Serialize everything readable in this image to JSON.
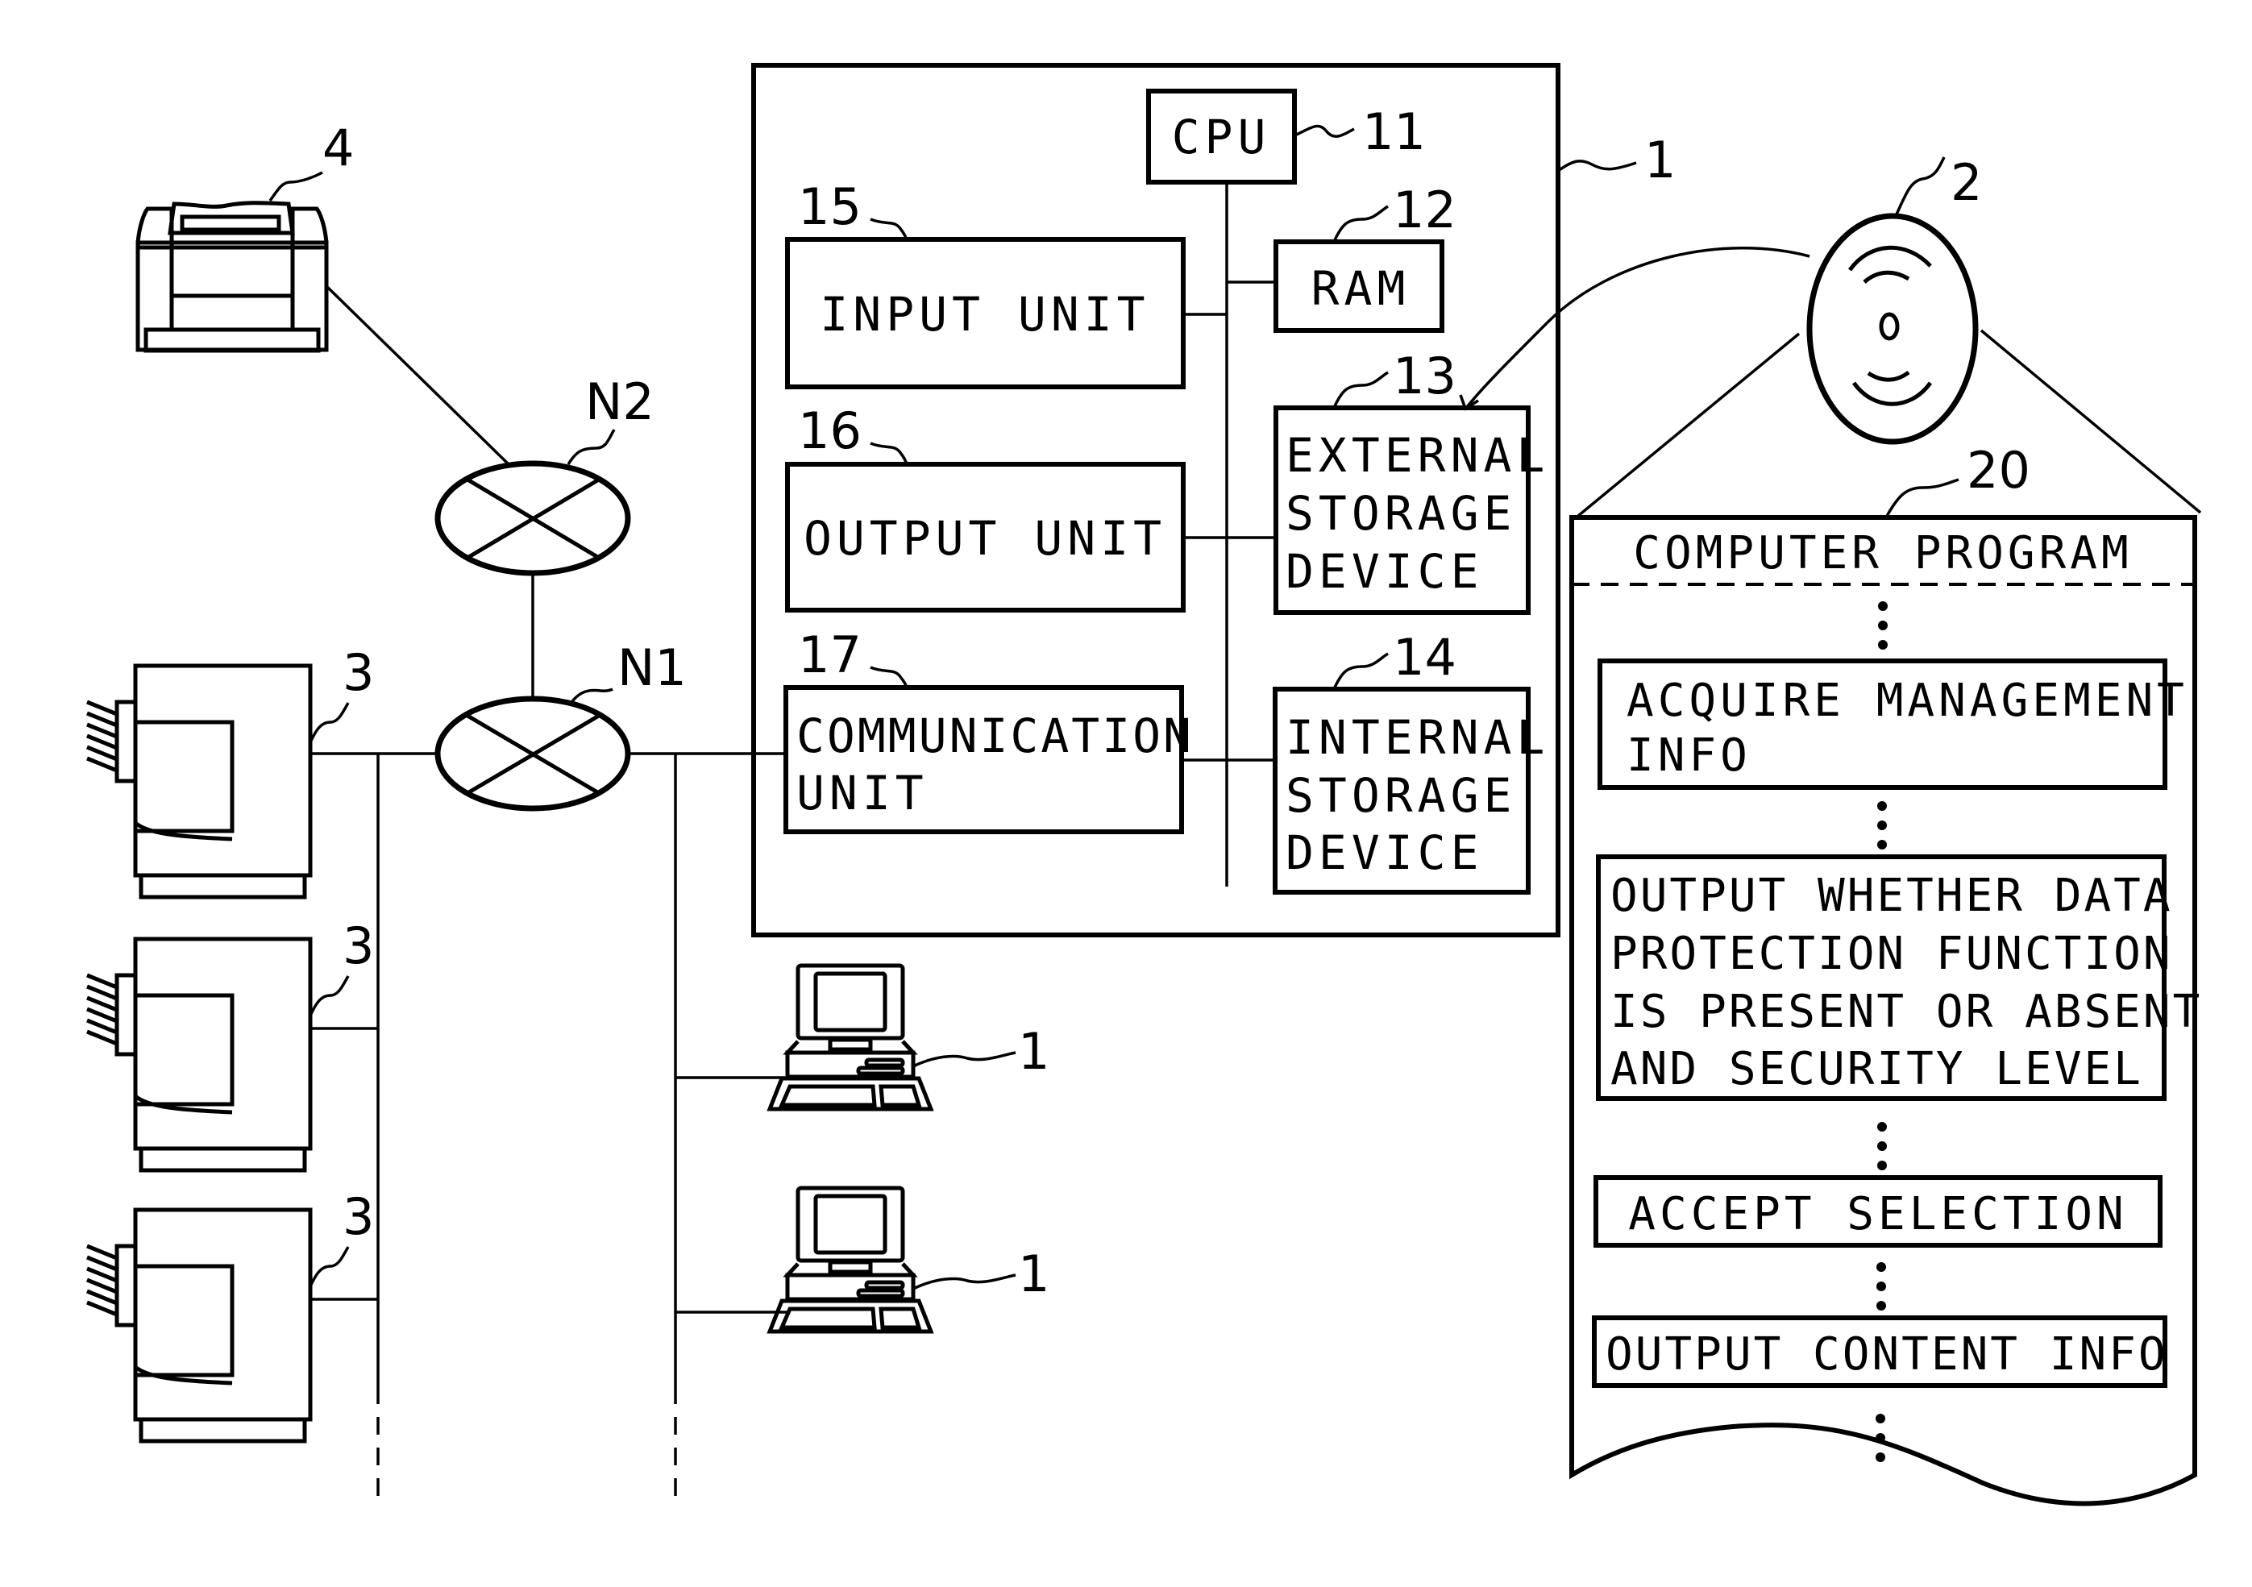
{
  "figure": {
    "description": "System block diagram: management device connected via networks to image forming apparatuses, printer and terminals; computer program on recording medium",
    "colors": {
      "ink": "#000000",
      "paper": "#ffffff"
    }
  },
  "main_device": {
    "ref": "1",
    "components": {
      "cpu": {
        "label": "CPU",
        "ref": "11"
      },
      "ram": {
        "label": "RAM",
        "ref": "12"
      },
      "external_storage": {
        "lines": [
          "EXTERNAL",
          "STORAGE",
          "DEVICE"
        ],
        "ref": "13"
      },
      "internal_storage": {
        "lines": [
          "INTERNAL",
          "STORAGE",
          "DEVICE"
        ],
        "ref": "14"
      },
      "input_unit": {
        "label": "INPUT UNIT",
        "ref": "15"
      },
      "output_unit": {
        "label": "OUTPUT UNIT",
        "ref": "16"
      },
      "communication_unit": {
        "lines": [
          "COMMUNICATION",
          "UNIT"
        ],
        "ref": "17"
      }
    }
  },
  "recording_medium": {
    "ref": "2",
    "icon": "optical-disc-icon"
  },
  "computer_program": {
    "ref": "20",
    "title": "COMPUTER PROGRAM",
    "steps": [
      {
        "lines": [
          "ACQUIRE MANAGEMENT",
          "INFO"
        ]
      },
      {
        "lines": [
          "OUTPUT WHETHER DATA",
          "PROTECTION FUNCTION",
          "IS PRESENT OR ABSENT",
          "AND SECURITY LEVEL"
        ]
      },
      {
        "lines": [
          "ACCEPT SELECTION"
        ]
      },
      {
        "lines": [
          "OUTPUT CONTENT INFO"
        ]
      }
    ],
    "ellipsis": "⋮"
  },
  "networks": [
    {
      "ref": "N2",
      "icon": "network-hub-icon"
    },
    {
      "ref": "N1",
      "icon": "network-hub-icon"
    }
  ],
  "printer": {
    "ref": "4",
    "icon": "printer-icon"
  },
  "image_forming_apparatuses": [
    {
      "ref": "3",
      "icon": "multifunction-printer-icon"
    },
    {
      "ref": "3",
      "icon": "multifunction-printer-icon"
    },
    {
      "ref": "3",
      "icon": "multifunction-printer-icon"
    }
  ],
  "terminals": [
    {
      "ref": "1",
      "icon": "desktop-computer-icon"
    },
    {
      "ref": "1",
      "icon": "desktop-computer-icon"
    }
  ]
}
